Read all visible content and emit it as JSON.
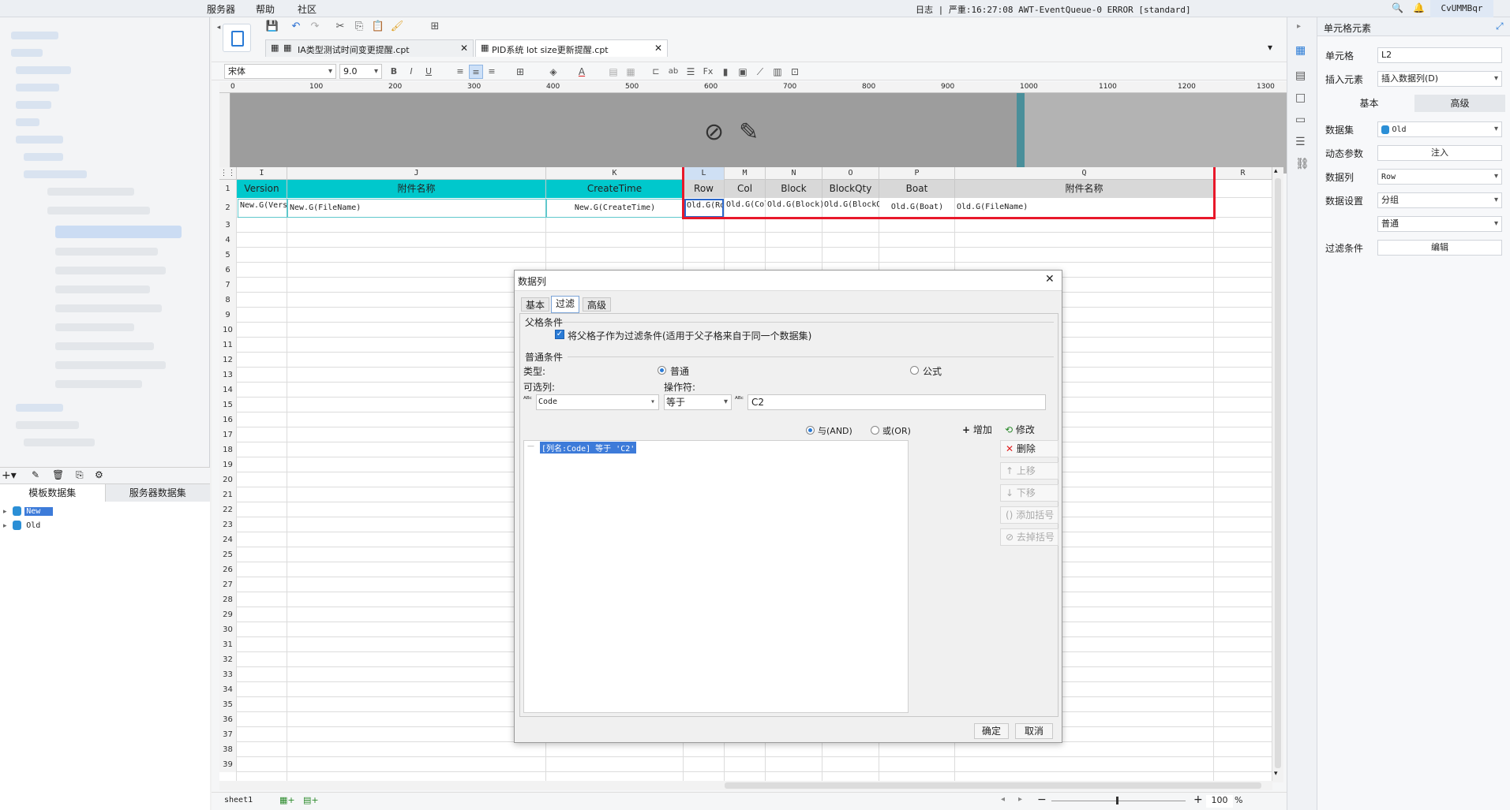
{
  "menubar": {
    "items": [
      "服务器",
      "帮助",
      "社区"
    ],
    "status": "日志 | 严重:16:27:08 AWT-EventQueue-0 ERROR [standard]",
    "user": "CvUMMBqr"
  },
  "tabs": [
    {
      "label": "IA类型测试时间变更提醒.cpt",
      "active": false
    },
    {
      "label": "PID系统 lot size更新提醒.cpt",
      "active": true
    }
  ],
  "format_bar": {
    "font": "宋体",
    "size": "9.0",
    "bold": "B",
    "italic": "I",
    "underline": "U",
    "font_color": "A"
  },
  "ruler": {
    "ticks": [
      "0",
      "100",
      "200",
      "300",
      "400",
      "500",
      "600",
      "700",
      "800",
      "900",
      "1000",
      "1100",
      "1200",
      "1300"
    ]
  },
  "grid": {
    "columns": [
      {
        "letter": "I",
        "header": "Version",
        "formula": "New.G(Version)"
      },
      {
        "letter": "J",
        "header": "附件名称",
        "formula": "New.G(FileName)"
      },
      {
        "letter": "K",
        "header": "CreateTime",
        "formula": "New.G(CreateTime)"
      },
      {
        "letter": "L",
        "header": "Row",
        "formula": "Old.G(Row)"
      },
      {
        "letter": "M",
        "header": "Col",
        "formula": "Old.G(Col)"
      },
      {
        "letter": "N",
        "header": "Block",
        "formula": "Old.G(Block)"
      },
      {
        "letter": "O",
        "header": "BlockQty",
        "formula": "Old.G(BlockQty)"
      },
      {
        "letter": "P",
        "header": "Boat",
        "formula": "Old.G(Boat)"
      },
      {
        "letter": "Q",
        "header": "附件名称",
        "formula": "Old.G(FileName)"
      },
      {
        "letter": "R",
        "header": "",
        "formula": ""
      }
    ],
    "row_numbers": [
      "1",
      "2",
      "3",
      "4",
      "5",
      "6",
      "7",
      "8",
      "9",
      "10",
      "11",
      "12",
      "13",
      "14",
      "15",
      "16",
      "17",
      "18",
      "19",
      "20",
      "21",
      "22",
      "23",
      "24",
      "25",
      "26",
      "27",
      "28",
      "29",
      "30",
      "31",
      "32",
      "33",
      "34",
      "35",
      "36",
      "37",
      "38",
      "39"
    ]
  },
  "datasets": {
    "toolbar": [
      "+",
      "edit",
      "delete",
      "preview",
      "params"
    ],
    "tabs": [
      "模板数据集",
      "服务器数据集"
    ],
    "items": [
      "New",
      "Old"
    ]
  },
  "sheet": {
    "name": "sheet1",
    "zoom": "100",
    "zoom_unit": "%"
  },
  "rightpanel": {
    "title": "单元格元素",
    "cell_label": "单元格",
    "cell_value": "L2",
    "insert_label": "插入元素",
    "insert_value": "插入数据列(D)",
    "tabs": [
      "基本",
      "高级"
    ],
    "dataset_label": "数据集",
    "dataset_value": "Old",
    "dynparam_label": "动态参数",
    "dynparam_btn": "注入",
    "column_label": "数据列",
    "column_value": "Row",
    "setting_label": "数据设置",
    "setting_value": "分组",
    "setting_value2": "普通",
    "filter_label": "过滤条件",
    "filter_btn": "编辑"
  },
  "dialog": {
    "title": "数据列",
    "tabs": [
      "基本",
      "过滤",
      "高级"
    ],
    "parent_section": "父格条件",
    "parent_checkbox": "将父格子作为过滤条件(适用于父子格来自于同一个数据集)",
    "normal_section": "普通条件",
    "type_label": "类型:",
    "type_normal": "普通",
    "type_formula": "公式",
    "col_label": "可选列:",
    "op_label": "操作符:",
    "col_value": "Code",
    "op_value": "等于",
    "value": "C2",
    "and_label": "与(AND)",
    "or_label": "或(OR)",
    "add_btn": "增加",
    "modify_btn": "修改",
    "condition": "[列名:Code] 等于 'C2'",
    "delete_btn": "删除",
    "up_btn": "上移",
    "down_btn": "下移",
    "add_bracket_btn": "添加括号",
    "remove_bracket_btn": "去掉括号",
    "ok_btn": "确定",
    "cancel_btn": "取消"
  }
}
